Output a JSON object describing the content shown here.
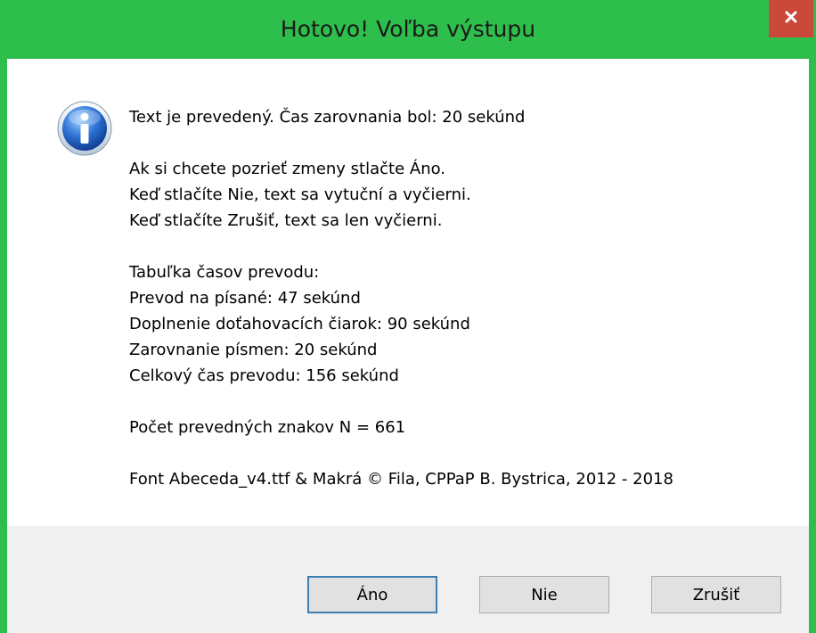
{
  "window": {
    "title": "Hotovo! Voľba výstupu",
    "accent_color": "#2ebe4b",
    "close_color": "#c94a3b",
    "close_glyph": "✕"
  },
  "dialog": {
    "icon": "info-icon",
    "line1": "Text je prevedený. Čas zarovnania bol: 20 sekúnd",
    "line2": "Ak si chcete pozrieť zmeny stlačte Áno.",
    "line3": "Keď stlačíte Nie, text sa vytuční a vyčierni.",
    "line4": "Keď stlačíte Zrušiť, text sa len vyčierni.",
    "table_title": "Tabuľka časov prevodu:",
    "row1": "Prevod na písané: 47 sekúnd",
    "row2": "Doplnenie doťahovacích čiarok: 90 sekúnd",
    "row3": "Zarovnanie písmen: 20 sekúnd",
    "row4": "Celkový čas prevodu: 156 sekúnd",
    "count": "Počet prevedných znakov N = 661",
    "credits": "Font Abeceda_v4.ttf & Makrá © Fila, CPPaP B. Bystrica, 2012 - 2018"
  },
  "buttons": {
    "yes": "Áno",
    "no": "Nie",
    "cancel": "Zrušiť"
  }
}
